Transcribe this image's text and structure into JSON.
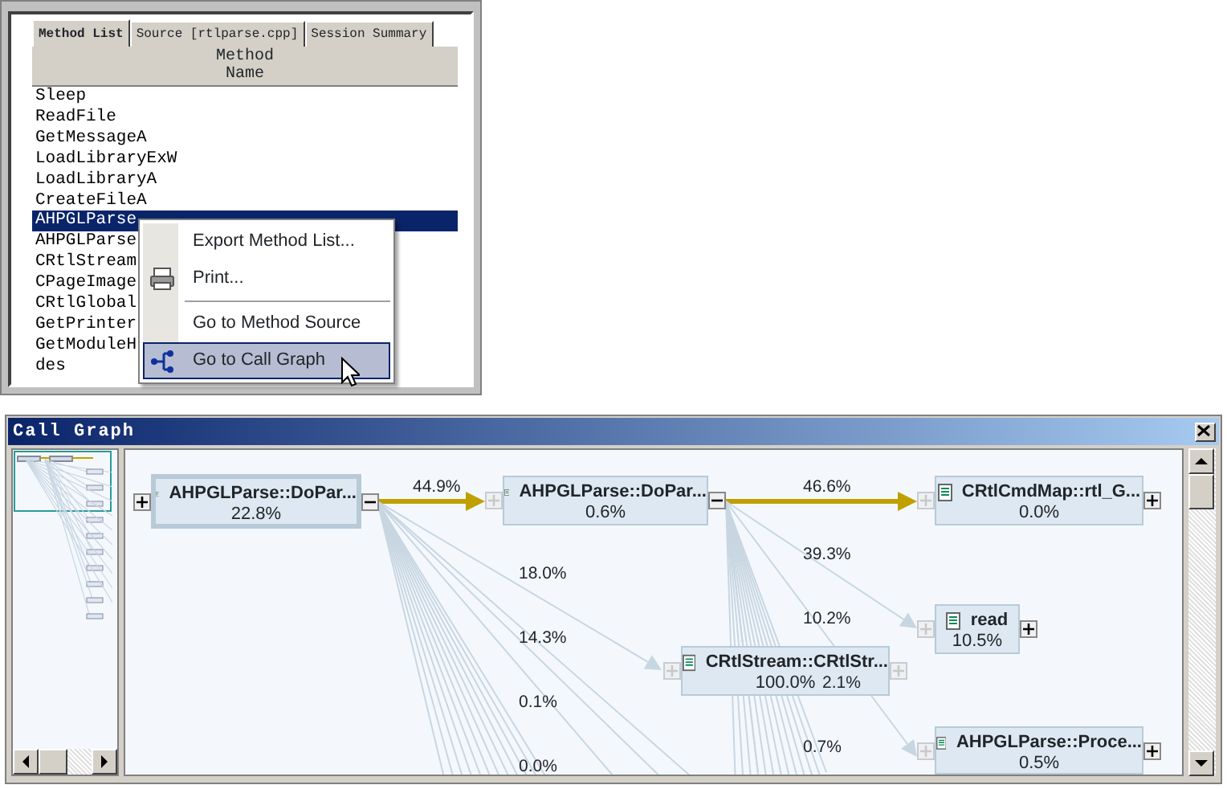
{
  "method_list_window": {
    "tabs": [
      {
        "label": "Method List",
        "selected": true
      },
      {
        "label": "Source [rtlparse.cpp]",
        "selected": false
      },
      {
        "label": "Session Summary",
        "selected": false
      }
    ],
    "column_header": "Method Name",
    "rows": [
      {
        "name": "Sleep",
        "selected": false
      },
      {
        "name": "ReadFile",
        "selected": false
      },
      {
        "name": "GetMessageA",
        "selected": false
      },
      {
        "name": "LoadLibraryExW",
        "selected": false
      },
      {
        "name": "LoadLibraryA",
        "selected": false
      },
      {
        "name": "CreateFileA",
        "selected": false
      },
      {
        "name": "AHPGLParse",
        "selected": true
      },
      {
        "name": "AHPGLParse",
        "selected": false
      },
      {
        "name": "CRtlStream",
        "selected": false
      },
      {
        "name": "CPageImage",
        "selected": false
      },
      {
        "name": "CRtlGlobal",
        "selected": false
      },
      {
        "name": "GetPrinter",
        "selected": false
      },
      {
        "name": "GetModuleH",
        "selected": false
      },
      {
        "name": "des",
        "selected": false
      }
    ],
    "context_menu": [
      {
        "kind": "plain",
        "label": "Export Method List...",
        "selected": false
      },
      {
        "kind": "print",
        "label": "Print...",
        "selected": false
      },
      {
        "kind": "separator"
      },
      {
        "kind": "plain",
        "label": "Go to Method Source",
        "selected": false
      },
      {
        "kind": "graph",
        "label": "Go to Call Graph",
        "selected": true
      }
    ]
  },
  "call_graph_window": {
    "title": "Call Graph",
    "nodes": [
      {
        "name": "AHPGLParse::DoPar...",
        "percent": "22.8%",
        "selected": true,
        "callers_enabled": true,
        "callers_expanded": false,
        "callees_enabled": true,
        "callees_expanded": true
      },
      {
        "name": "AHPGLParse::DoPar...",
        "percent": "0.6%",
        "selected": false,
        "callers_enabled": false,
        "callers_expanded": false,
        "callees_enabled": true,
        "callees_expanded": true
      },
      {
        "name": "CRtlCmdMap::rtl_G...",
        "percent": "0.0%",
        "selected": false,
        "callers_enabled": false,
        "callers_expanded": false,
        "callees_enabled": true,
        "callees_expanded": false
      },
      {
        "name": "read",
        "percent": "10.5%",
        "selected": false,
        "callers_enabled": false,
        "callers_expanded": false,
        "callees_enabled": true,
        "callees_expanded": false
      },
      {
        "name": "CRtlStream::CRtlStr...",
        "percent": "100.0%",
        "selected": false,
        "callers_enabled": false,
        "callers_expanded": false,
        "callees_enabled": false,
        "callees_expanded": false
      },
      {
        "name": "AHPGLParse::Proce...",
        "percent": "0.5%",
        "selected": false,
        "callers_enabled": false,
        "callers_expanded": false,
        "callees_enabled": true,
        "callees_expanded": false
      }
    ],
    "edges": [
      {
        "label": "44.9%",
        "hot": true
      },
      {
        "label": "46.6%",
        "hot": true
      },
      {
        "label": "18.0%",
        "hot": false
      },
      {
        "label": "39.3%",
        "hot": false
      },
      {
        "label": "14.3%",
        "hot": false
      },
      {
        "label": "10.2%",
        "hot": false
      },
      {
        "label": "0.1%",
        "hot": false
      },
      {
        "label": "2.1%",
        "hot": false
      },
      {
        "label": "0.0%",
        "hot": false
      },
      {
        "label": "0.7%",
        "hot": false
      }
    ]
  }
}
